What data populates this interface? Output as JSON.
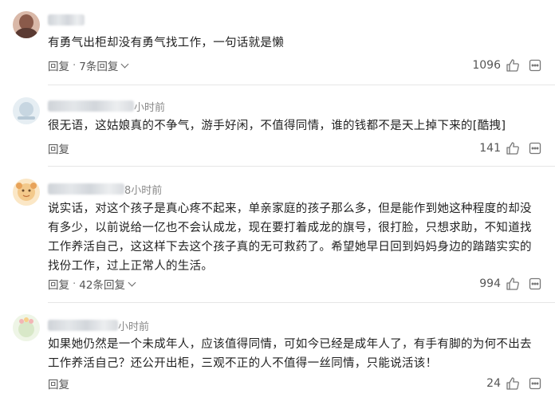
{
  "comments": [
    {
      "time": "",
      "text": "有勇气出柜却没有勇气找工作，一句话就是懒",
      "reply_label": "回复",
      "sep": "·",
      "replies_label": "7条回复",
      "likes": "1096",
      "avatar_colors": [
        "#8a5a4a",
        "#d9b8a8"
      ]
    },
    {
      "time": "小时前",
      "text": "很无语，这姑娘真的不争气，游手好闲，不值得同情，谁的钱都不是天上掉下来的[酷拽]",
      "reply_label": "回复",
      "likes": "141",
      "avatar_colors": [
        "#dbe6ee",
        "#b7c9d6"
      ]
    },
    {
      "time": "8小时前",
      "text": "说实话，对这个孩子是真心疼不起来，单亲家庭的孩子那么多，但是能作到她这种程度的却没有多少，以前说给一亿也不会认成龙，现在要打着成龙的旗号，很打脸，只想求助，不知道找工作养活自己，这这样下去这个孩子真的无可救药了。希望她早日回到妈妈身边的踏踏实实的找份工作，过上正常人的生活。",
      "reply_label": "回复",
      "sep": "·",
      "replies_label": "42条回复",
      "likes": "994",
      "avatar_colors": [
        "#f3c98b",
        "#e8a35a"
      ]
    },
    {
      "time": "小时前",
      "text": "如果她仍然是一个未成年人，应该值得同情，可如今已经是成年人了，有手有脚的为何不出去工作养活自己？还公开出柜，三观不正的人不值得一丝同情，只能说活该！",
      "reply_label": "回复",
      "likes": "24",
      "avatar_colors": [
        "#d8e8c8",
        "#f2b6b6"
      ]
    }
  ],
  "icons": {
    "like": "thumbs-up-icon",
    "more": "more-icon"
  },
  "colors": {
    "text": "#222222",
    "meta": "#888888",
    "divider": "#e6e6e6"
  }
}
